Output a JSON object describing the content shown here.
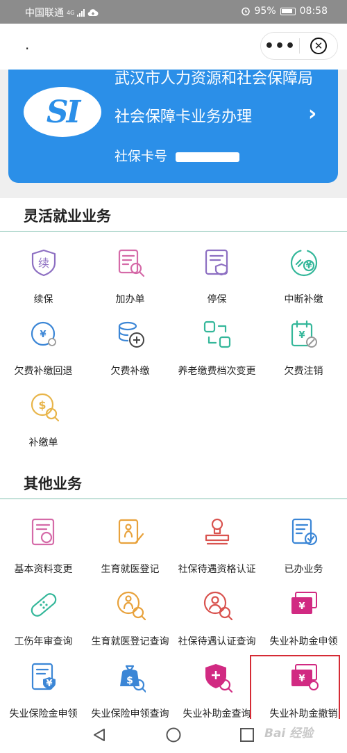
{
  "status_bar": {
    "carrier": "中国联通",
    "network": "4G",
    "battery": "95%",
    "time": "08:58"
  },
  "nav": {
    "title": ".",
    "more_label": "•••",
    "close_label": "✕"
  },
  "card": {
    "org": "武汉市人力资源和社会保障局",
    "logo_text": "SI",
    "title": "社会保障卡业务办理",
    "chevron": "›",
    "card_no_label": "社保卡号 "
  },
  "section1": {
    "title": "灵活就业业务",
    "items": [
      {
        "label": "续保",
        "icon": "renew-shield-icon",
        "color": "#8d6fc2"
      },
      {
        "label": "加办单",
        "icon": "add-form-search-icon",
        "color": "#d56aa8"
      },
      {
        "label": "停保",
        "icon": "stop-insurance-doc-icon",
        "color": "#8d6fc2"
      },
      {
        "label": "中断补缴",
        "icon": "chain-yuan-icon",
        "color": "#34b79a"
      },
      {
        "label": "欠费补缴回退",
        "icon": "yuan-circle-back-icon",
        "color": "#3b86d6"
      },
      {
        "label": "欠费补缴",
        "icon": "coins-plus-icon",
        "color": "#3b86d6"
      },
      {
        "label": "养老缴费档次变更",
        "icon": "swap-squares-icon",
        "color": "#34b79a"
      },
      {
        "label": "欠费注销",
        "icon": "calendar-yuan-cancel-icon",
        "color": "#34b79a"
      },
      {
        "label": "补缴单",
        "icon": "coin-search-icon",
        "color": "#e8b54a"
      }
    ]
  },
  "section2": {
    "title": "其他业务",
    "items": [
      {
        "label": "基本资料变更",
        "icon": "profile-change-icon",
        "color": "#d56aa8"
      },
      {
        "label": "生育就医登记",
        "icon": "maternity-register-icon",
        "color": "#e8a23c"
      },
      {
        "label": "社保待遇资格认证",
        "icon": "stamp-icon",
        "color": "#d9534f"
      },
      {
        "label": "已办业务",
        "icon": "done-list-icon",
        "color": "#3b86d6"
      },
      {
        "label": "工伤年审查询",
        "icon": "bandage-icon",
        "color": "#34b79a"
      },
      {
        "label": "生育就医登记查询",
        "icon": "maternity-search-icon",
        "color": "#e8a23c"
      },
      {
        "label": "社保待遇认证查询",
        "icon": "person-search-icon",
        "color": "#d9534f"
      },
      {
        "label": "失业补助金申领",
        "icon": "yuan-cards-icon",
        "color": "#d12a82"
      },
      {
        "label": "失业保险金申领",
        "icon": "insurance-yuan-doc-icon",
        "color": "#3b86d6"
      },
      {
        "label": "失业保险申领查询",
        "icon": "bag-search-icon",
        "color": "#3b86d6"
      },
      {
        "label": "失业补助金查询",
        "icon": "shield-plus-search-icon",
        "color": "#d12a82"
      },
      {
        "label": "失业补助金撤销",
        "icon": "yuan-cards-undo-icon",
        "color": "#d12a82"
      }
    ]
  },
  "bottom_nav": {
    "back": "back-triangle-icon",
    "home": "home-circle-icon",
    "recent": "recent-square-icon"
  },
  "watermark": "Bai 经验"
}
